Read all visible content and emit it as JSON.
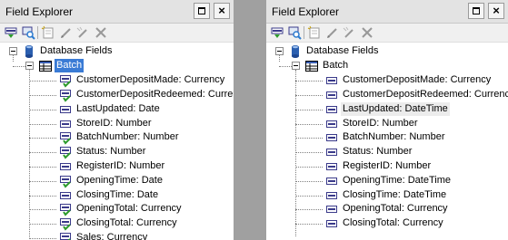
{
  "left_panel": {
    "title": "Field Explorer",
    "pin_label": "",
    "close_label": "×",
    "toolbar": [
      "insert-field-icon",
      "browse-data-icon",
      "new-field-icon",
      "edit-icon",
      "rename-icon",
      "delete-icon"
    ],
    "root_label": "Database Fields",
    "table_label": "Batch",
    "table_selected": true,
    "fields": [
      {
        "label": "CustomerDepositMade: Currency",
        "icon": "field-used-icon"
      },
      {
        "label": "CustomerDepositRedeemed: Currency",
        "icon": "field-used-icon"
      },
      {
        "label": "LastUpdated: Date",
        "icon": "field-icon"
      },
      {
        "label": "StoreID: Number",
        "icon": "field-icon"
      },
      {
        "label": "BatchNumber: Number",
        "icon": "field-used-icon"
      },
      {
        "label": "Status: Number",
        "icon": "field-used-icon"
      },
      {
        "label": "RegisterID: Number",
        "icon": "field-icon"
      },
      {
        "label": "OpeningTime: Date",
        "icon": "field-used-icon"
      },
      {
        "label": "ClosingTime: Date",
        "icon": "field-icon"
      },
      {
        "label": "OpeningTotal: Currency",
        "icon": "field-used-icon"
      },
      {
        "label": "ClosingTotal: Currency",
        "icon": "field-used-icon"
      },
      {
        "label": "Sales: Currency",
        "icon": "field-used-icon"
      }
    ]
  },
  "right_panel": {
    "title": "Field Explorer",
    "pin_label": "",
    "close_label": "×",
    "toolbar": [
      "insert-field-icon",
      "browse-data-icon",
      "new-field-icon",
      "edit-icon",
      "rename-icon",
      "delete-icon"
    ],
    "root_label": "Database Fields",
    "table_label": "Batch",
    "table_selected": false,
    "fields": [
      {
        "label": "CustomerDepositMade: Currency",
        "icon": "field-icon"
      },
      {
        "label": "CustomerDepositRedeemed: Currency",
        "icon": "field-icon"
      },
      {
        "label": "LastUpdated: DateTime",
        "icon": "field-icon",
        "highlight": true
      },
      {
        "label": "StoreID: Number",
        "icon": "field-icon"
      },
      {
        "label": "BatchNumber: Number",
        "icon": "field-icon"
      },
      {
        "label": "Status: Number",
        "icon": "field-icon"
      },
      {
        "label": "RegisterID: Number",
        "icon": "field-icon"
      },
      {
        "label": "OpeningTime: DateTime",
        "icon": "field-icon"
      },
      {
        "label": "ClosingTime: DateTime",
        "icon": "field-icon"
      },
      {
        "label": "OpeningTotal: Currency",
        "icon": "field-icon"
      },
      {
        "label": "ClosingTotal: Currency",
        "icon": "field-icon"
      }
    ]
  },
  "colors": {
    "selection": "#3a7bd5",
    "field_icon": "#3a3a8a",
    "check": "#2c9a2c"
  }
}
